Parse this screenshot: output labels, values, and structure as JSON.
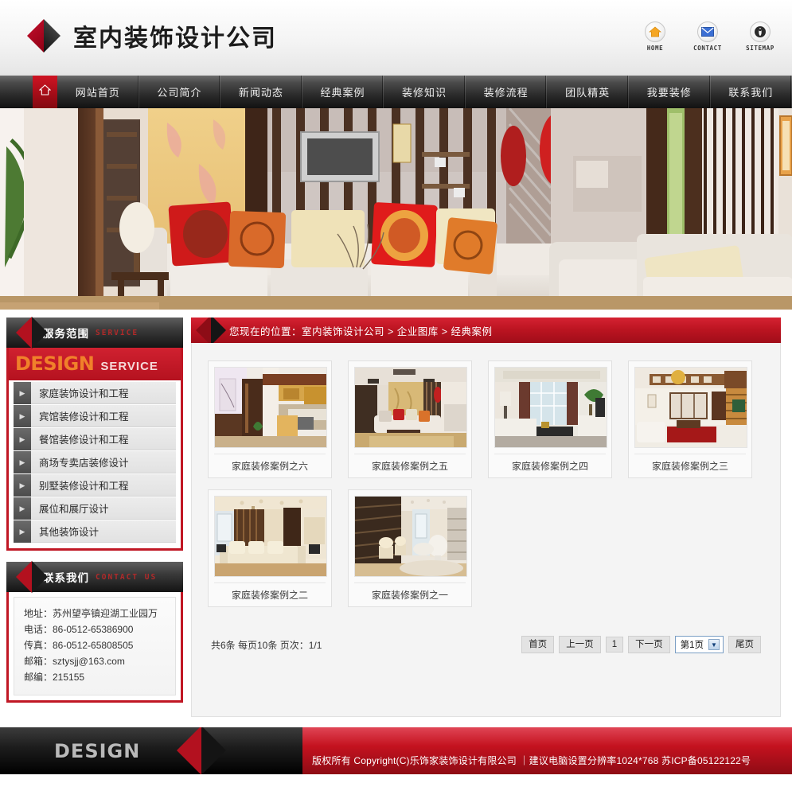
{
  "header": {
    "site_title": "室内装饰设计公司",
    "logo_icon": "diamond-logo-icon",
    "quick_icons": [
      {
        "label": "HOME",
        "icon": "home-icon"
      },
      {
        "label": "CONTACT",
        "icon": "envelope-icon"
      },
      {
        "label": "SITEMAP",
        "icon": "sitemap-pin-icon"
      }
    ]
  },
  "nav": {
    "home_icon": "house-icon",
    "items": [
      "网站首页",
      "公司简介",
      "新闻动态",
      "经典案例",
      "装修知识",
      "装修流程",
      "团队精英",
      "我要装修",
      "联系我们"
    ]
  },
  "sidebar": {
    "service_panel": {
      "title_cn": "服务范围",
      "title_en": "SERVICE",
      "banner_main": "DESIGN",
      "banner_sub": "SERVICE",
      "items": [
        "家庭装饰设计和工程",
        "宾馆装修设计和工程",
        "餐馆装修设计和工程",
        "商场专卖店装修设计",
        "别墅装修设计和工程",
        "展位和展厅设计",
        "其他装饰设计"
      ]
    },
    "contact_panel": {
      "title_cn": "联系我们",
      "title_en": "CONTACT US",
      "lines": [
        "地址：苏州望亭镇迎湖工业园万",
        "电话：86-0512-65386900",
        "传真：86-0512-65808505",
        "邮箱：sztysjj@163.com",
        "邮编：215155"
      ]
    }
  },
  "main": {
    "breadcrumb": "您现在的位置：室内装饰设计公司  > 企业图库  > 经典案例",
    "gallery": [
      {
        "caption": "家庭装修案例之六"
      },
      {
        "caption": "家庭装修案例之五"
      },
      {
        "caption": "家庭装修案例之四"
      },
      {
        "caption": "家庭装修案例之三"
      },
      {
        "caption": "家庭装修案例之二"
      },
      {
        "caption": "家庭装修案例之一"
      }
    ],
    "pager": {
      "info": "共6条 每页10条 页次：1/1",
      "first": "首页",
      "prev": "上一页",
      "current_num": "1",
      "next": "下一页",
      "select_value": "第1页",
      "last": "尾页"
    }
  },
  "footer": {
    "design_word": "DESIGN",
    "copyright": "版权所有  Copyright(C)乐饰家装饰设计有限公司  ｜建议电脑设置分辨率1024*768 苏ICP备05122122号"
  },
  "colors": {
    "brand_red": "#c01724",
    "banner_red": "#bb1421",
    "orange": "#f0802a",
    "nav_dark": "#2c2c2c"
  }
}
